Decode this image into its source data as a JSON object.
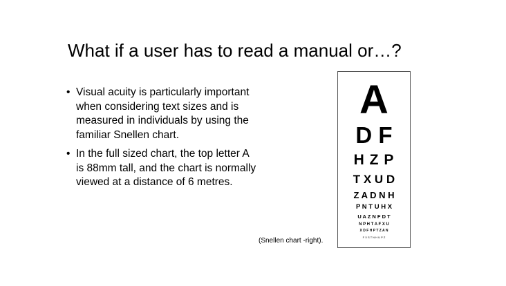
{
  "slide": {
    "title": "What if a user has to read a manual or…?",
    "bullets": [
      "Visual acuity is particularly important when considering text sizes and is measured in individuals by using the familiar Snellen chart.",
      "In the full sized chart, the top letter A is 88mm tall, and the chart is normally viewed at a distance of 6 metres."
    ],
    "bullet_glyph": "•",
    "caption": "(Snellen chart -right)."
  },
  "snellen": {
    "rows": [
      "A",
      "D F",
      "H Z P",
      "T X U D",
      "Z A D N H",
      "P N T U H X",
      "U A Z N F D T",
      "N P H T A F X U",
      "X D F H P T Z A N",
      "F X S T N H U P Z"
    ]
  }
}
